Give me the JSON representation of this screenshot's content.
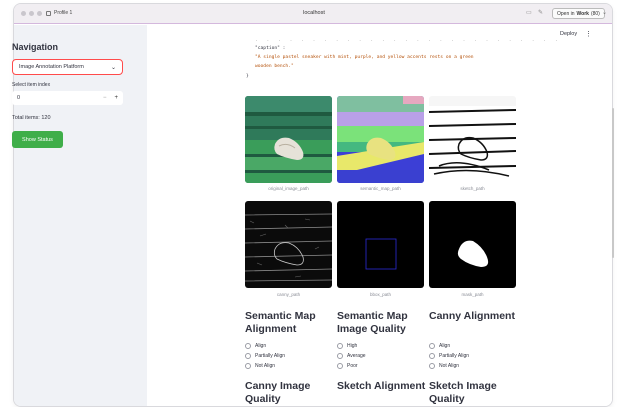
{
  "browser": {
    "profile_label": "Profile 1",
    "url": "localhost",
    "open_in_prefix": "Open in",
    "open_in_app": "Work",
    "open_in_suffix": "(80)"
  },
  "header": {
    "deploy_label": "Deploy",
    "menu_glyph": "⋮"
  },
  "sidebar": {
    "title": "Navigation",
    "select_value": "Image Annotation Platform",
    "index_label": "Select item index",
    "index_value": "0",
    "minus": "−",
    "plus": "+",
    "total_items": "Total items: 120",
    "show_status_label": "Show Status"
  },
  "json_view": {
    "key_line": "\"caption\" :",
    "value_line1": "\"A single pastel sneaker with mint, purple, and yellow accents rests on a green",
    "value_line2": "wooden bench.\"",
    "close_brace": "}"
  },
  "images": [
    {
      "caption": "original_image_path"
    },
    {
      "caption": "semantic_map_path"
    },
    {
      "caption": "sketch_path"
    },
    {
      "caption": "canny_path"
    },
    {
      "caption": "bbox_path"
    },
    {
      "caption": "mask_path"
    }
  ],
  "questions": [
    {
      "title": "Semantic Map Alignment",
      "options": [
        "Align",
        "Partially Align",
        "Not Align"
      ]
    },
    {
      "title": "Semantic Map Image Quality",
      "options": [
        "High",
        "Average",
        "Poor"
      ]
    },
    {
      "title": "Canny Alignment",
      "options": [
        "Align",
        "Partially Align",
        "Not Align"
      ]
    },
    {
      "title": "Canny Image Quality",
      "options": []
    },
    {
      "title": "Sketch Alignment",
      "options": []
    },
    {
      "title": "Sketch Image Quality",
      "options": []
    }
  ]
}
